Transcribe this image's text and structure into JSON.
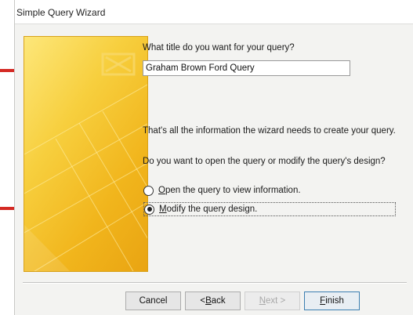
{
  "window": {
    "title": "Simple Query Wizard"
  },
  "main": {
    "title_prompt": "What title do you want for your query?",
    "title_value": "Graham Brown Ford Query",
    "info_text": "That's all the information the wizard needs to create your query.",
    "question": "Do you want to open the query or modify the query's design?",
    "options": [
      {
        "label_prefix": "",
        "label_key": "O",
        "label_rest": "pen the query to view information.",
        "selected": false
      },
      {
        "label_prefix": "",
        "label_key": "M",
        "label_rest": "odify the query design.",
        "selected": true
      }
    ]
  },
  "buttons": {
    "cancel": "Cancel",
    "back_prefix": "< ",
    "back_key": "B",
    "back_rest": "ack",
    "next_key": "N",
    "next_rest": "ext >",
    "finish_key": "F",
    "finish_rest": "inish"
  },
  "colors": {
    "arrow": "#d42a24",
    "wizard_art": "#f4c22e"
  }
}
